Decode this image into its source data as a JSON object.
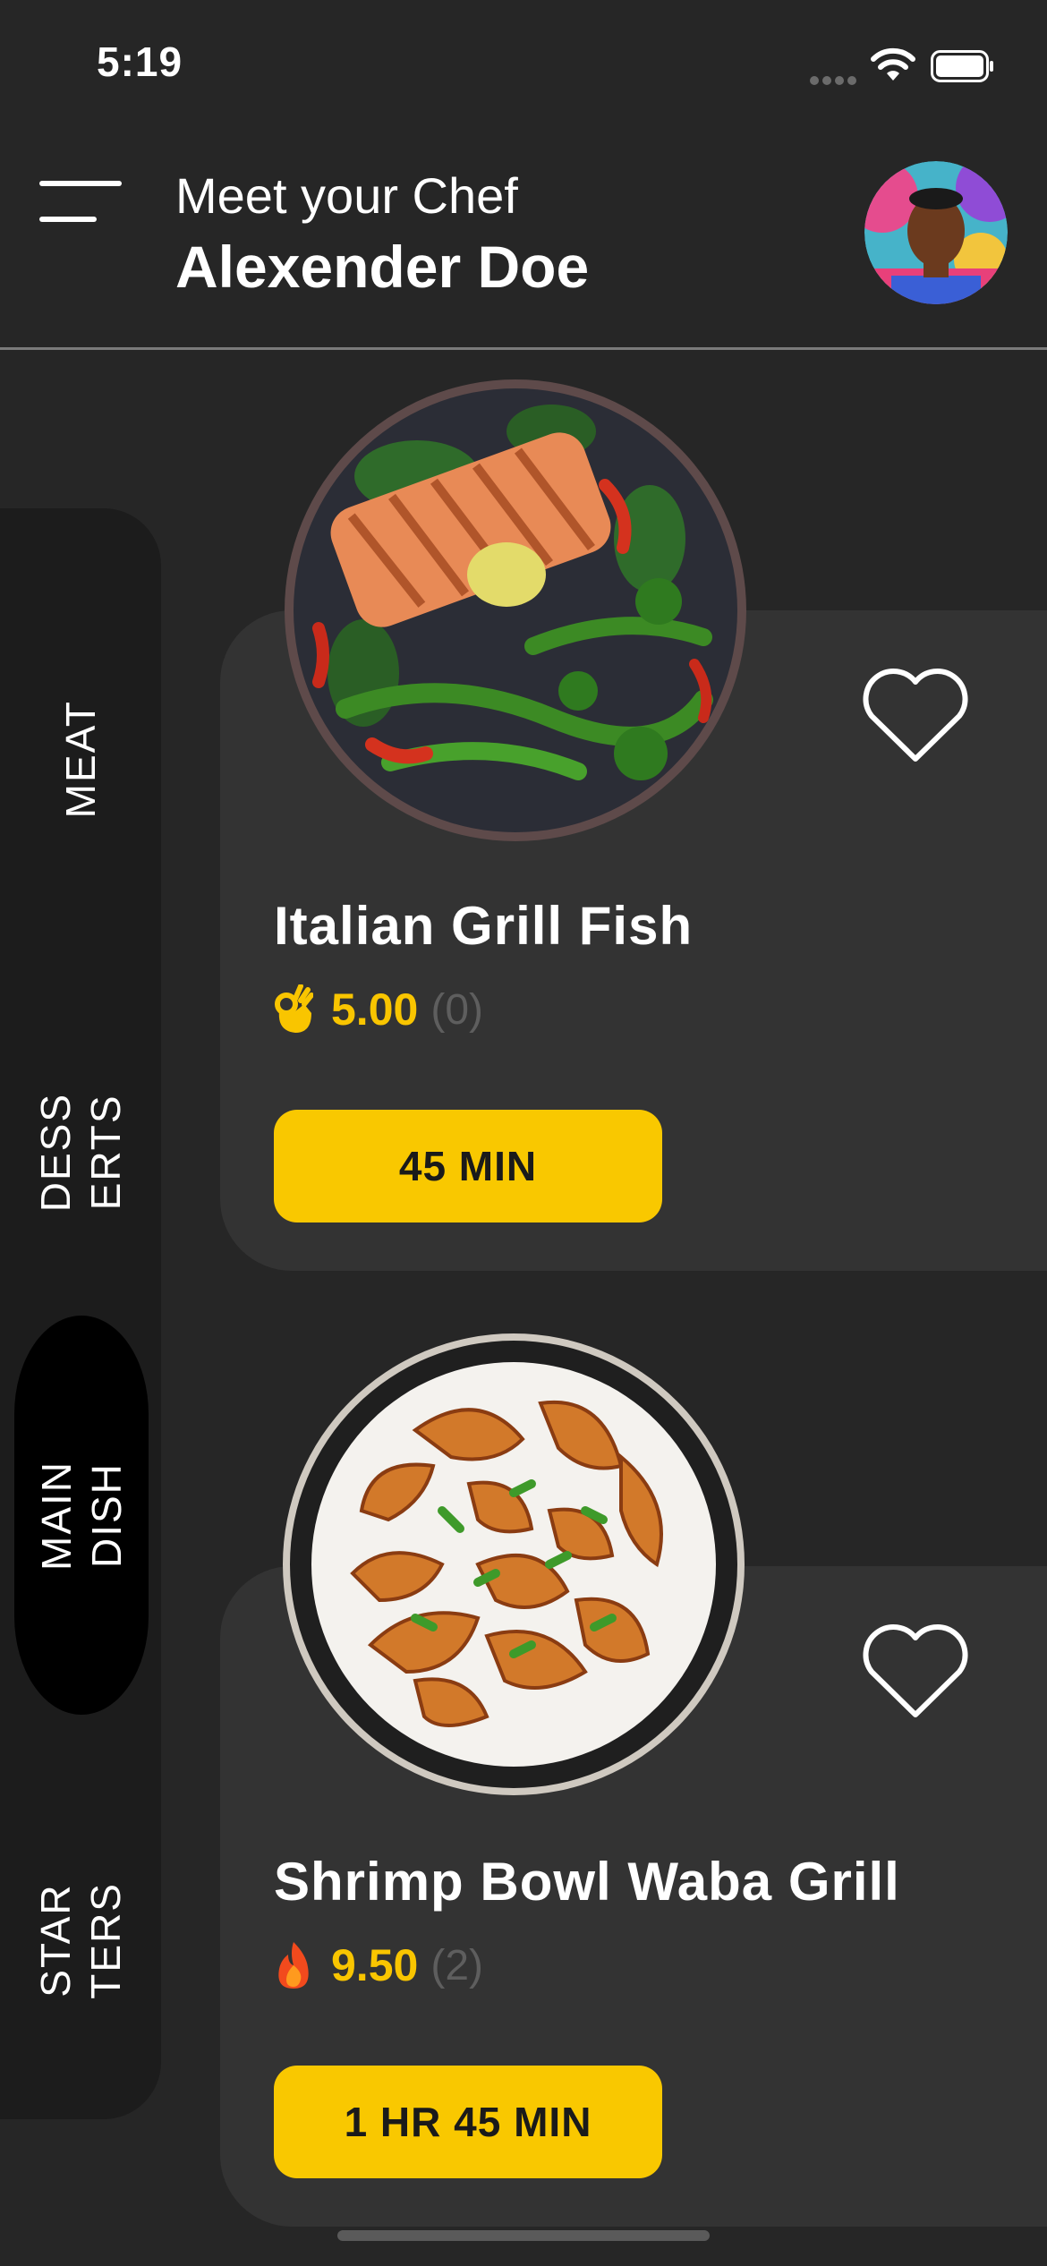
{
  "status_bar": {
    "time": "5:19"
  },
  "header": {
    "subtitle": "Meet your Chef",
    "chef_name": "Alexender Doe"
  },
  "sidebar": {
    "items": [
      {
        "label": "MEAT",
        "active": false
      },
      {
        "label": "DESS\nERTS",
        "active": false
      },
      {
        "label": "MAIN\nDISH",
        "active": true
      },
      {
        "label": "STAR\nTERS",
        "active": false
      }
    ]
  },
  "dishes": [
    {
      "name": "Italian Grill Fish",
      "rating_icon": "ok-hand-icon",
      "rating": "5.00",
      "rating_count": "(0)",
      "time": "45 MIN"
    },
    {
      "name": "Shrimp Bowl Waba Grill",
      "rating_icon": "fire-icon",
      "rating": "9.50",
      "rating_count": "(2)",
      "time": "1 HR 45 MIN"
    }
  ],
  "colors": {
    "background": "#262626",
    "card": "#333333",
    "sidebar": "#1c1c1c",
    "accent": "#f9c800",
    "rating_text": "#f9c500",
    "muted": "#5e5e5e"
  }
}
